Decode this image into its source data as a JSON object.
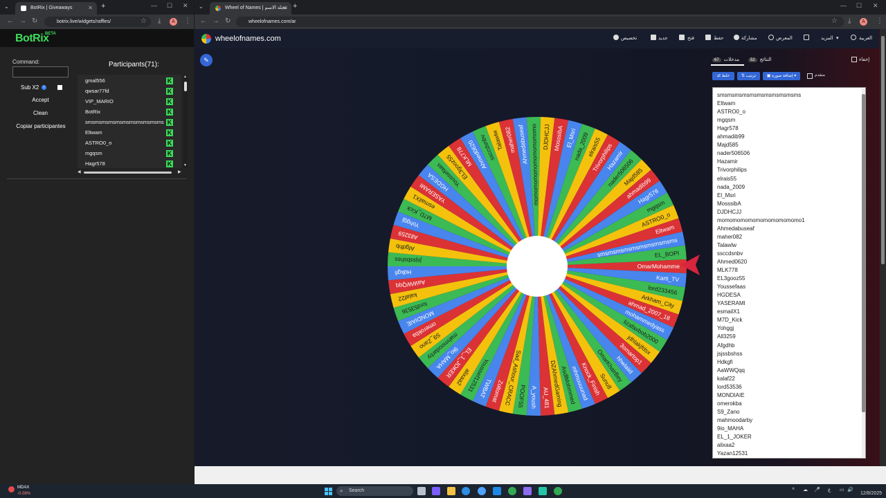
{
  "left_window": {
    "tab_title": "BotRix | Giveaways",
    "url": "botrix.live/widgets/raffles/",
    "avatar_letter": "A"
  },
  "right_window": {
    "tab_title": "Wheel of Names | عجلة الاسم العشوائي",
    "url": "wheelofnames.com/ar",
    "avatar_letter": "A"
  },
  "botrix": {
    "logo": "BotRix",
    "beta": "BETA",
    "command_label": "Command:",
    "command_value": "",
    "subx2_label": "Sub X2",
    "accept": "Accept",
    "clean": "Clean",
    "copy": "Copiar participantes",
    "participants_title": "Participants(71):",
    "participants": [
      {
        "name": "gmal556",
        "badge": true
      },
      {
        "name": "qwsar77fd",
        "badge": true
      },
      {
        "name": "VIP_MARIO",
        "badge": true
      },
      {
        "name": "BotRix",
        "badge": true
      },
      {
        "name": "smsmsmsmsmsmsmsmsmsmsms",
        "badge": true
      },
      {
        "name": "Eltwam",
        "badge": true
      },
      {
        "name": "ASTRO0_o",
        "badge": true
      },
      {
        "name": "mgqsm",
        "badge": true
      },
      {
        "name": "Hagr578",
        "badge": true
      }
    ]
  },
  "wheel": {
    "site_name": "wheelofnames.com",
    "menu": [
      "تخصيص",
      "جديد",
      "فتح",
      "حفظ",
      "مشاركة",
      "المعرض",
      "المزيد",
      "العربية"
    ],
    "tab_entries_label": "مدخلات",
    "tab_entries_count": "67",
    "tab_results_label": "النتائج",
    "tab_results_count": "52",
    "hide_label": "إخفاء",
    "btn_shuffle": "خلط",
    "btn_sort": "ترتيب",
    "btn_add_image": "إضافة صورة",
    "advanced_label": "متقدم",
    "entries": [
      "smsmsmsmsmsmsmsmsmsmsms",
      "Eltwam",
      "ASTRO0_o",
      "mgqsm",
      "Hagr578",
      "ahmadib99",
      "Majd585",
      "nader506506",
      "Hazamir",
      "Trivorphilips",
      "elrais55",
      "nada_2009",
      "El_Msri",
      "MosssibA",
      "DJDHCJJ",
      "momomomomomomomomomomo1",
      "Ahmedabuseaf",
      "maher082",
      "Talawlw",
      "ssccdsnbv",
      "Ahmed0620",
      "MLK778",
      "EL3gooz55",
      "Youssefaas",
      "HGDESA",
      "YASERAMI",
      "esmailX1",
      "M7D_Kick",
      "Yohggj",
      "All3259",
      "Afgdhb",
      "jsjssbshss",
      "Hdkgfi",
      "AaWWQqq",
      "kalaf22",
      "lord53536",
      "MONDIAIE",
      "omerokba",
      "S9_Zano",
      "mahmoodarby",
      "9io_MAHA",
      "EL_1_JOKER",
      "alixaa2",
      "Yazan12531"
    ],
    "slice_labels": [
      "OmarMohamme",
      "Karti_TV",
      "lord233456",
      "Arkham_City",
      "ahmad_2007_18",
      "mohammedyass",
      "lizafaxbob2000",
      "jdhlakjfdsx",
      "3omartop1",
      "hhwlaiid",
      "OmarKhairBey",
      "Sunu8",
      "Knock_Finish",
      "mhmuuuunad",
      "AsdlMohmmed",
      "DZAhmedGaming",
      "AU_481",
      "A_yoush",
      "POOF55",
      "Sad_Ashour_CRACC",
      "Zoltomat",
      "TWBAT",
      "Youssef12531",
      "alixaa2",
      "EL_1_JOKER",
      "9io_MAHA",
      "mahmoodarby",
      "S9_Zano",
      "omerokba",
      "MONDIAIE",
      "lord53536",
      "kalaf22",
      "AaWWQqq",
      "Hdkgfi",
      "jsjssbshss",
      "Afgdhb",
      "All3259",
      "Yohggj",
      "M7D_Kick",
      "esmailX1",
      "YASERAMI",
      "HGDESA",
      "Youssefaas",
      "EL3gooz55",
      "MLK778",
      "Ahmed0620",
      "ssccdsnbv",
      "Talawlw",
      "maher082",
      "Ahmedabuseaf",
      "momomomomomomomomomo",
      "DJDHCJJ",
      "MosssibA",
      "El_Msri",
      "nada_2009",
      "elrais55",
      "Trivorphilips",
      "Hazamir",
      "nader506506",
      "Majd585",
      "ahmadib99",
      "Hagr578",
      "mgqsm",
      "ASTRO0_o",
      "Eltwam",
      "smsmsmsmsmsmsmsmsmsms",
      "EL_BOPI"
    ],
    "slice_colors": [
      "#db3236",
      "#4885ed",
      "#3cba54",
      "#f4c20d"
    ]
  },
  "taskbar": {
    "stock_name": "MDAX",
    "stock_change": "-0.08%",
    "search_placeholder": "Search",
    "date": "12/8/2025"
  }
}
